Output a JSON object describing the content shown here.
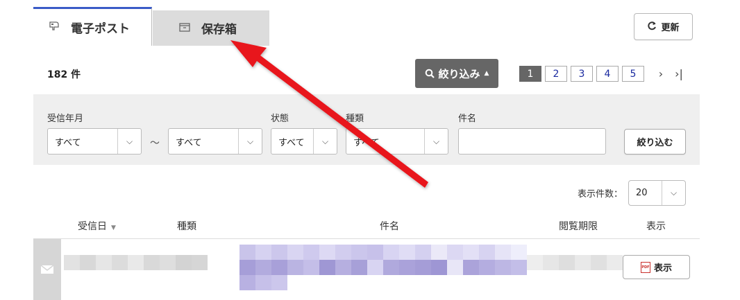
{
  "tabs": [
    {
      "label": "電子ポスト",
      "icon": "mailbox-icon",
      "active": true
    },
    {
      "label": "保存箱",
      "icon": "archive-box-icon",
      "active": false
    }
  ],
  "toolbar": {
    "refresh_label": "更新",
    "refresh_icon": "refresh-icon"
  },
  "list": {
    "count_text": "182 件"
  },
  "filter_toggle": {
    "label": "絞り込み",
    "caret": "▲",
    "icon": "search-icon"
  },
  "pagination": {
    "pages": [
      "1",
      "2",
      "3",
      "4",
      "5"
    ],
    "current": "1",
    "next": "›",
    "last": "›|"
  },
  "filters": {
    "received_label": "受信年月",
    "received_from": "すべて",
    "range_sep": "〜",
    "received_to": "すべて",
    "status_label": "状態",
    "status_value": "すべて",
    "type_label": "種類",
    "type_value": "すべて",
    "subject_label": "件名",
    "subject_value": "",
    "apply_label": "絞り込む"
  },
  "per_page": {
    "label": "表示件数：",
    "value": "20"
  },
  "table": {
    "headers": {
      "received": "受信日",
      "type": "種類",
      "subject": "件名",
      "period": "閲覧期限",
      "view": "表示"
    },
    "sort_caret": "▼",
    "rows": [
      {
        "view_label": "表示",
        "pdf_badge": "PDF",
        "icon": "envelope-icon"
      }
    ]
  },
  "colors": {
    "accent": "#3a5bc7",
    "arrow": "#e8121b",
    "toggle_bg": "#666666",
    "filter_bg": "#efefef"
  }
}
